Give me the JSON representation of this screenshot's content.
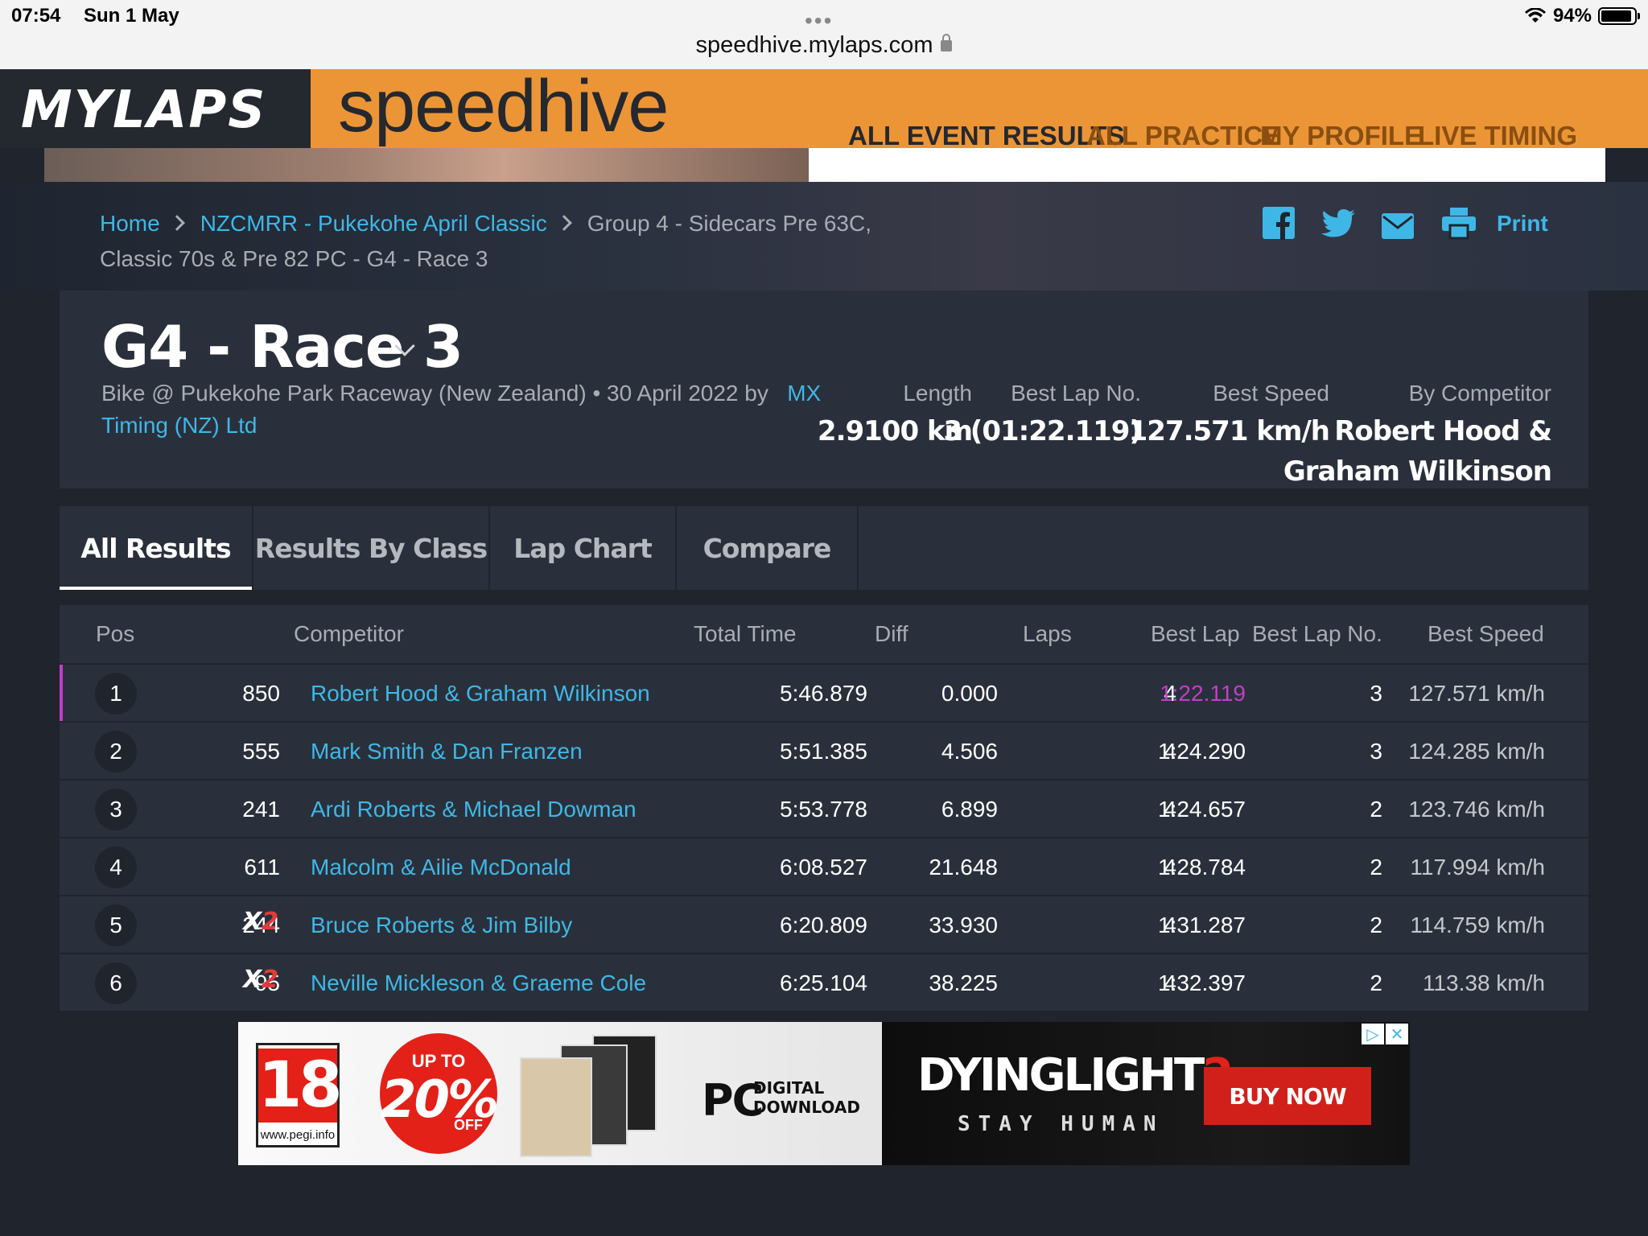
{
  "status_bar": {
    "time": "07:54",
    "date": "Sun 1 May",
    "url": "speedhive.mylaps.com",
    "battery": "94%"
  },
  "header": {
    "logo": "MYLAPS",
    "brand": "speedhive",
    "nav": [
      {
        "label": "ALL EVENT RESULTS",
        "active": true
      },
      {
        "label": "ALL PRACTICE",
        "active": false
      },
      {
        "label": "MY PROFILE",
        "active": false
      },
      {
        "label": "LIVE TIMING",
        "active": false
      }
    ]
  },
  "breadcrumb": {
    "home": "Home",
    "event": "NZCMRR - Pukekohe April Classic",
    "current_line1": "Group 4 - Sidecars Pre 63C,",
    "current_line2": "Classic 70s & Pre 82 PC - G4 - Race 3"
  },
  "share": {
    "print_label": "Print"
  },
  "race": {
    "title": "G4 - Race 3",
    "subtitle": "Bike @ Pukekohe Park Raceway (New Zealand) • 30 April 2022 by",
    "organizer_line1": "MX",
    "organizer_line2": "Timing (NZ) Ltd",
    "stats": {
      "length_label": "Length",
      "length_value": "2.9100 km",
      "best_lap_no_label": "Best Lap No.",
      "best_lap_no_value": "3 (01:22.119)",
      "best_speed_label": "Best Speed",
      "best_speed_value": "127.571 km/h",
      "by_competitor_label": "By Competitor",
      "by_competitor_line1": "Robert Hood &",
      "by_competitor_line2": "Graham Wilkinson"
    }
  },
  "tabs": [
    "All Results",
    "Results By Class",
    "Lap Chart",
    "Compare"
  ],
  "table": {
    "headers": {
      "pos": "Pos",
      "competitor": "Competitor",
      "total_time": "Total Time",
      "diff": "Diff",
      "laps": "Laps",
      "best_lap": "Best Lap",
      "best_lap_no": "Best Lap No.",
      "best_speed": "Best Speed"
    },
    "rows": [
      {
        "pos": "1",
        "number": "850",
        "class_badge": "",
        "competitor": "Robert Hood & Graham Wilkinson",
        "total_time": "5:46.879",
        "diff": "0.000",
        "laps": "4",
        "best_lap": "1:22.119",
        "best_lap_no": "3",
        "best_speed": "127.571 km/h"
      },
      {
        "pos": "2",
        "number": "555",
        "class_badge": "",
        "competitor": "Mark Smith & Dan Franzen",
        "total_time": "5:51.385",
        "diff": "4.506",
        "laps": "4",
        "best_lap": "1:24.290",
        "best_lap_no": "3",
        "best_speed": "124.285 km/h"
      },
      {
        "pos": "3",
        "number": "241",
        "class_badge": "",
        "competitor": "Ardi Roberts & Michael Dowman",
        "total_time": "5:53.778",
        "diff": "6.899",
        "laps": "4",
        "best_lap": "1:24.657",
        "best_lap_no": "2",
        "best_speed": "123.746 km/h"
      },
      {
        "pos": "4",
        "number": "611",
        "class_badge": "",
        "competitor": "Malcolm & Ailie McDonald",
        "total_time": "6:08.527",
        "diff": "21.648",
        "laps": "4",
        "best_lap": "1:28.784",
        "best_lap_no": "2",
        "best_speed": "117.994 km/h"
      },
      {
        "pos": "5",
        "number": "244",
        "class_badge": "X2",
        "competitor": "Bruce Roberts & Jim Bilby",
        "total_time": "6:20.809",
        "diff": "33.930",
        "laps": "4",
        "best_lap": "1:31.287",
        "best_lap_no": "2",
        "best_speed": "114.759 km/h"
      },
      {
        "pos": "6",
        "number": "95",
        "class_badge": "X2",
        "competitor": "Neville Mickleson & Graeme Cole",
        "total_time": "6:25.104",
        "diff": "38.225",
        "laps": "4",
        "best_lap": "1:32.397",
        "best_lap_no": "2",
        "best_speed": "113.38 km/h"
      }
    ]
  },
  "ad": {
    "pegi_rating": "18",
    "pegi_url": "www.pegi.info",
    "promo_top": "UP TO",
    "promo_pct": "20%",
    "promo_bottom": "OFF",
    "platform": "PC",
    "platform_sub1": "DIGITAL",
    "platform_sub2": "DOWNLOAD",
    "game_title": "DYINGLIGHT",
    "game_num": "2",
    "tagline": "STAY HUMAN",
    "cta": "BUY NOW"
  },
  "colors": {
    "accent_orange": "#ec9536",
    "link_blue": "#3fb7e6",
    "best_lap_magenta": "#c23ec9",
    "panel_bg": "#2a303b",
    "page_bg": "#1f242d"
  },
  "icons": [
    "facebook-icon",
    "twitter-icon",
    "mail-icon",
    "print-icon",
    "lock-icon",
    "wifi-icon",
    "battery-icon",
    "chevron-right-icon",
    "chevron-down-icon"
  ]
}
